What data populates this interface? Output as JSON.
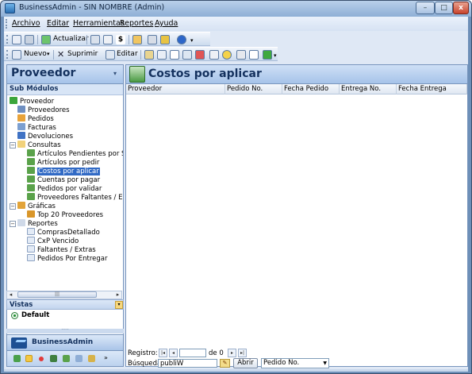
{
  "window": {
    "title": "BusinessAdmin - SIN NOMBRE (Admin)"
  },
  "menu": {
    "items": [
      "Archivo",
      "Editar",
      "Herramientas",
      "Reportes",
      "Ayuda"
    ]
  },
  "toolbar1": {
    "refresh_label": "Actualizar"
  },
  "toolbar2": {
    "new_label": "Nuevo",
    "delete_label": "Suprimir",
    "edit_label": "Editar"
  },
  "left": {
    "title": "Proveedor",
    "submodules_label": "Sub Módulos",
    "tree": [
      {
        "label": "Proveedor"
      },
      {
        "label": "Proveedores"
      },
      {
        "label": "Pedidos"
      },
      {
        "label": "Facturas"
      },
      {
        "label": "Devoluciones"
      },
      {
        "label": "Consultas"
      },
      {
        "label": "Artículos Pendientes por S"
      },
      {
        "label": "Artículos por pedir"
      },
      {
        "label": "Costos por aplicar"
      },
      {
        "label": "Cuentas por pagar"
      },
      {
        "label": "Pedidos por validar"
      },
      {
        "label": "Proveedores Faltantes / Ex"
      },
      {
        "label": "Gráficas"
      },
      {
        "label": "Top 20 Proveedores"
      },
      {
        "label": "Reportes"
      },
      {
        "label": "ComprasDetallado"
      },
      {
        "label": "CxP Vencido"
      },
      {
        "label": "Faltantes / Extras"
      },
      {
        "label": "Pedidos Por Entregar"
      }
    ],
    "vistas_label": "Vistas",
    "vista_default": "Default",
    "app_name": "BusinessAdmin"
  },
  "main": {
    "title": "Costos por aplicar",
    "columns": [
      "Proveedor",
      "Pedido No.",
      "Fecha Pedido",
      "Entrega No.",
      "Fecha Entrega"
    ],
    "nav": {
      "registro_label": "Registro:",
      "position": "",
      "of_label": "de 0"
    },
    "search": {
      "label": "Búsqueda",
      "value": "publiW",
      "open_label": "Abrir",
      "field_selected": "Pedido No."
    }
  },
  "colors": {
    "accent": "#14315e",
    "selected": "#316ac5",
    "frame": "#7895bd"
  }
}
